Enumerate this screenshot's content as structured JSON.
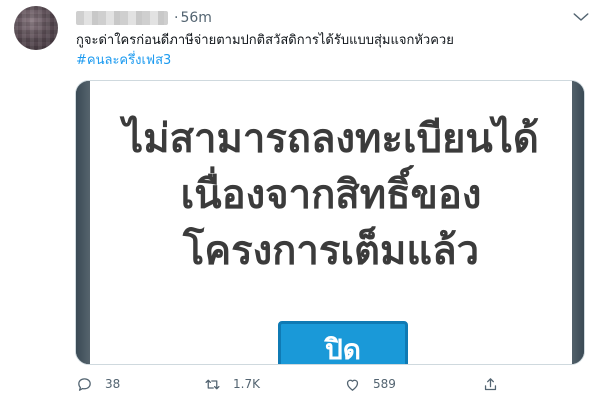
{
  "tweet": {
    "time": "56m",
    "separator": "·",
    "text": "กูจะด่าใครก่อนดีภาษีจ่ายตามปกติสวัสดิการได้รับแบบสุ่มแจกหัวควย",
    "hashtag": "#คนละครึ่งเฟส3"
  },
  "media": {
    "message_line1": "ไม่สามารถลงทะเบียนได้",
    "message_line2": "เนื่องจากสิทธิ์ของ",
    "message_line3": "โครงการเต็มแล้ว",
    "button_label": "ปิด"
  },
  "actions": {
    "reply_count": "38",
    "retweet_count": "1.7K",
    "like_count": "589"
  },
  "colors": {
    "hashtag": "#1d9bf0",
    "secondary_text": "#536471",
    "dialog_button": "#1a99d8"
  }
}
